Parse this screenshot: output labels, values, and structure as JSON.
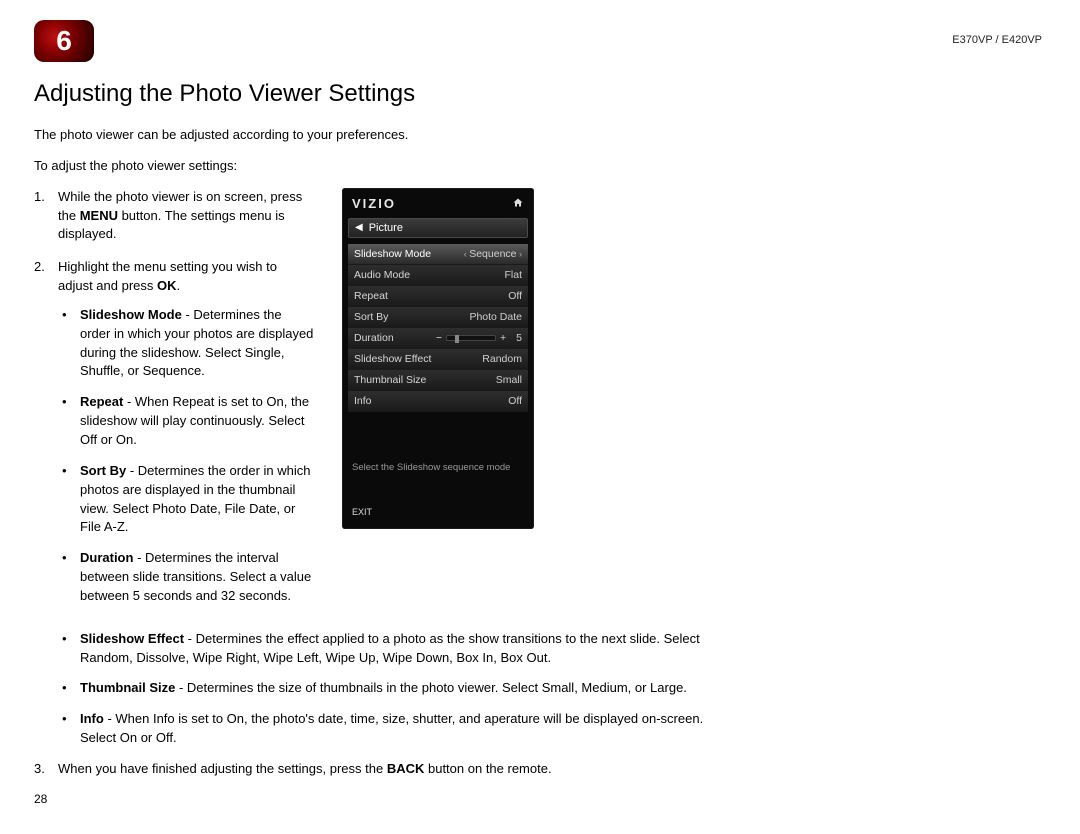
{
  "chapter_number": "6",
  "model_label": "E370VP / E420VP",
  "section_title": "Adjusting the Photo Viewer Settings",
  "intro": "The photo viewer can be adjusted according to your preferences.",
  "lead_in": "To adjust the photo viewer settings:",
  "steps": {
    "s1_a": "While the photo viewer is on screen, press the ",
    "s1_b": "MENU",
    "s1_c": " button. The settings menu is displayed.",
    "s2_a": "Highlight the menu setting you wish to adjust and press ",
    "s2_b": "OK",
    "s2_c": ".",
    "s3_a": "When you have finished adjusting the settings, press the ",
    "s3_b": "BACK",
    "s3_c": " button on the remote."
  },
  "bullets": {
    "slideshow_mode": {
      "label": "Slideshow Mode",
      "desc": " - Determines the order in which your photos are displayed during the slideshow. Select Single, Shuffle, or Sequence."
    },
    "repeat": {
      "label": "Repeat",
      "desc": " - When Repeat is set to On, the slideshow will play continuously. Select Off or On."
    },
    "sort_by": {
      "label": "Sort By",
      "desc": " - Determines the order in which photos are displayed in the thumbnail view. Select Photo Date, File Date, or File A-Z."
    },
    "duration": {
      "label": "Duration",
      "desc": " - Determines the interval between slide transitions. Select a value between 5 seconds and 32 seconds."
    },
    "slideshow_effect": {
      "label": "Slideshow Effect",
      "desc": " - Determines the effect applied to a photo as the show transitions to the next slide. Select Random, Dissolve, Wipe Right, Wipe Left, Wipe Up, Wipe Down, Box In, Box Out."
    },
    "thumbnail_size": {
      "label": "Thumbnail Size",
      "desc": " - Determines the size of thumbnails in the photo viewer. Select Small, Medium, or Large."
    },
    "info": {
      "label": "Info",
      "desc": " - When Info is set to On, the photo's date, time, size, shutter, and aperature will be displayed on-screen. Select On or Off."
    }
  },
  "tv_menu": {
    "brand": "VIZIO",
    "crumb": "Picture",
    "rows": [
      {
        "label": "Slideshow Mode",
        "value": "Sequence",
        "selected": true
      },
      {
        "label": "Audio Mode",
        "value": "Flat"
      },
      {
        "label": "Repeat",
        "value": "Off"
      },
      {
        "label": "Sort By",
        "value": "Photo Date"
      },
      {
        "label": "Duration",
        "value": "5",
        "slider": true
      },
      {
        "label": "Slideshow Effect",
        "value": "Random"
      },
      {
        "label": "Thumbnail Size",
        "value": "Small"
      },
      {
        "label": "Info",
        "value": "Off"
      }
    ],
    "hint": "Select the Slideshow sequence mode",
    "exit": "EXIT"
  },
  "page_number": "28"
}
